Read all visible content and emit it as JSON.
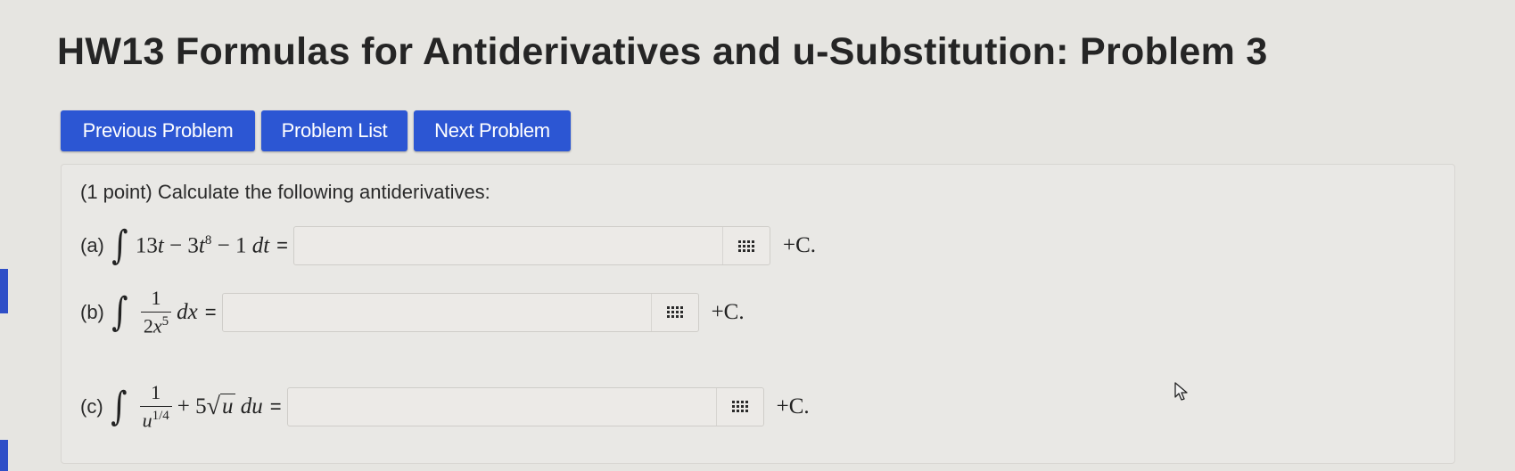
{
  "page_title": "HW13 Formulas for Antiderivatives and u-Substitution: Problem 3",
  "nav": {
    "previous": "Previous Problem",
    "list": "Problem List",
    "next": "Next Problem"
  },
  "problem": {
    "prompt": "(1 point) Calculate the following antiderivatives:",
    "parts": [
      {
        "label": "(a)",
        "answer_value": "",
        "suffix": "+C."
      },
      {
        "label": "(b)",
        "answer_value": "",
        "suffix": "+C."
      },
      {
        "label": "(c)",
        "answer_value": "",
        "suffix": "+C."
      }
    ]
  },
  "icons": {
    "equation_editor": "grid-icon",
    "mouse_pointer": "cursor-arrow-icon"
  },
  "colors": {
    "background": "#e6e5e1",
    "button_blue": "#2c56d3",
    "accent": "#2f4fc7"
  }
}
